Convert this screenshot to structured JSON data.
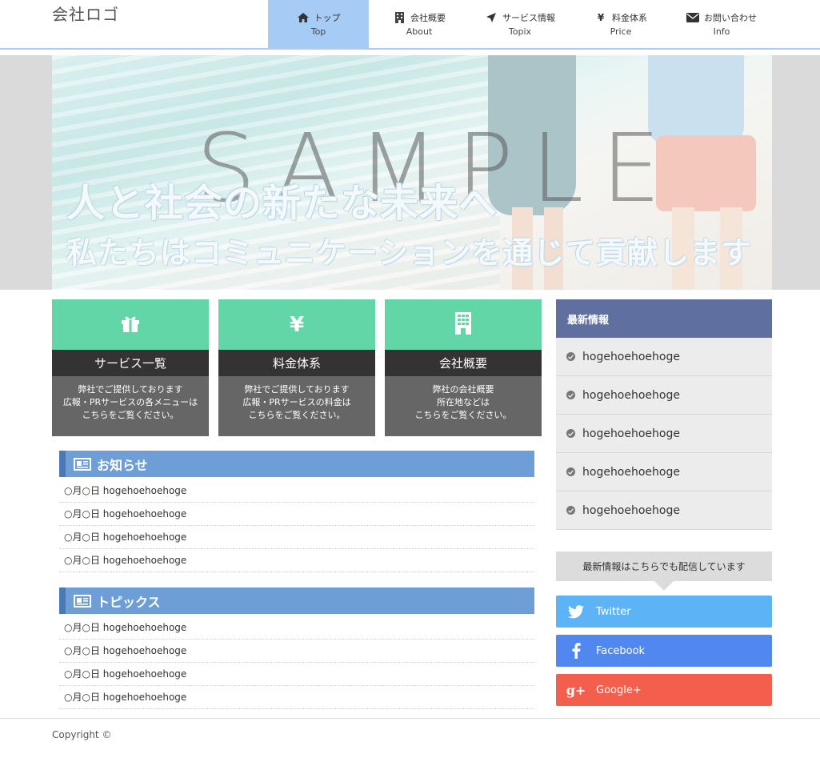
{
  "header": {
    "logo": "会社ロゴ",
    "nav": [
      {
        "label": "トップ",
        "sub": "Top",
        "icon": "home-icon",
        "active": true
      },
      {
        "label": "会社概要",
        "sub": "About",
        "icon": "building-icon",
        "active": false
      },
      {
        "label": "サービス情報",
        "sub": "Topix",
        "icon": "location-arrow-icon",
        "active": false
      },
      {
        "label": "料金体系",
        "sub": "Price",
        "icon": "yen-icon",
        "active": false
      },
      {
        "label": "お問い合わせ",
        "sub": "Info",
        "icon": "envelope-icon",
        "active": false
      }
    ],
    "active_color": "#a6ccf5"
  },
  "hero": {
    "watermark": "SAMPLE",
    "catch_line1": "人と社会の新たな未来へ",
    "catch_line2": "私たちはコミュニケーションを通じて貢献します"
  },
  "cards": [
    {
      "icon": "gift-icon",
      "title": "サービス一覧",
      "body": [
        "弊社でご提供しております",
        "広報・PRサービスの各メニューは",
        "こちらをご覧ください。"
      ]
    },
    {
      "icon": "yen-icon",
      "title": "料金体系",
      "body": [
        "弊社でご提供しております",
        "広報・PRサービスの料金は",
        "こちらをご覧ください。"
      ]
    },
    {
      "icon": "building-icon",
      "title": "会社概要",
      "body": [
        "弊社の会社概要",
        "所在地などは",
        "こちらをご覧ください。"
      ]
    }
  ],
  "news": {
    "title": "お知らせ",
    "items": [
      "○月○日 hogehoehoehoge",
      "○月○日 hogehoehoehoge",
      "○月○日 hogehoehoehoge",
      "○月○日 hogehoehoehoge"
    ]
  },
  "topics": {
    "title": "トピックス",
    "items": [
      "○月○日 hogehoehoehoge",
      "○月○日 hogehoehoehoge",
      "○月○日 hogehoehoehoge",
      "○月○日 hogehoehoehoge"
    ]
  },
  "sidebar": {
    "title": "最新情報",
    "items": [
      "hogehoehoehoge",
      "hogehoehoehoge",
      "hogehoehoehoge",
      "hogehoehoehoge",
      "hogehoehoehoge"
    ],
    "share_text": "最新情報はこちらでも配信しています",
    "sns": [
      {
        "label": "Twitter",
        "icon": "twitter-icon",
        "color": "#5cb4f7"
      },
      {
        "label": "Facebook",
        "icon": "facebook-icon",
        "color": "#5088ef"
      },
      {
        "label": "Google+",
        "icon": "google-plus-icon",
        "color": "#f45e4d"
      }
    ]
  },
  "footer": {
    "copyright": "Copyright ©"
  }
}
